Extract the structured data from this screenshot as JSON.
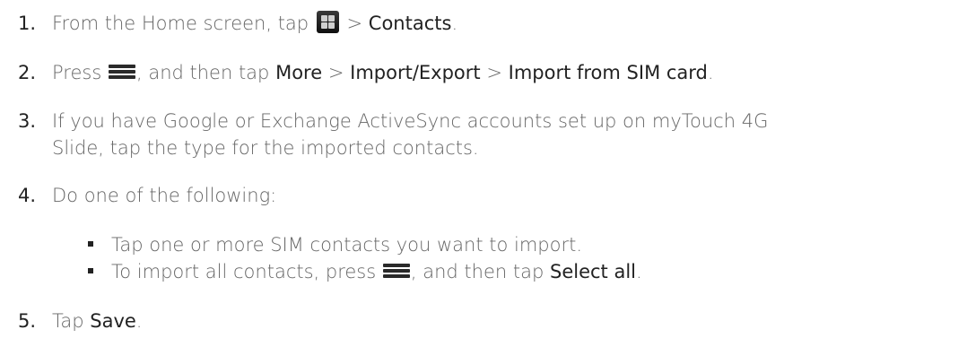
{
  "steps": [
    {
      "num": "1.",
      "pre": "From the Home screen, tap",
      "icon": "apps-grid-icon",
      "mid": ">",
      "target": "Contacts",
      "end": "."
    },
    {
      "num": "2.",
      "pre": "Press",
      "icon": "menu-icon",
      "mid": ", and then tap",
      "items": [
        "More",
        "Import/Export",
        "Import from SIM card"
      ],
      "sep": ">",
      "end": "."
    },
    {
      "num": "3.",
      "line1": "If you have Google or Exchange ActiveSync accounts set up on myTouch 4G",
      "line2": "Slide, tap the type for the imported contacts."
    },
    {
      "num": "4.",
      "text": "Do one of the following:",
      "bullets": [
        {
          "text": "Tap one or more SIM contacts you want to import."
        },
        {
          "pre": "To import all contacts, press",
          "icon": "menu-icon",
          "mid": ", and then tap",
          "target": "Select all",
          "end": "."
        }
      ]
    },
    {
      "num": "5.",
      "pre": "Tap",
      "target": "Save",
      "end": "."
    }
  ]
}
